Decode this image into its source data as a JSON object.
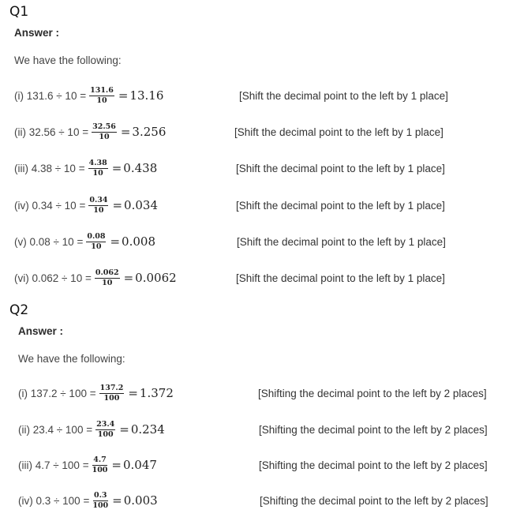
{
  "q1": {
    "title": "Q1",
    "answer_label": "Answer :",
    "intro": "We have the following:",
    "rows": [
      {
        "expr": "(i) 131.6 ÷ 10 =",
        "num": "131.6",
        "den": "10",
        "result": "13.16",
        "note": "[Shift the decimal point to the left by 1 place]"
      },
      {
        "expr": "(ii) 32.56 ÷ 10 =",
        "num": "32.56",
        "den": "10",
        "result": "3.256",
        "note": "[Shift the decimal point to the left by 1 place]"
      },
      {
        "expr": "(iii) 4.38 ÷ 10 =",
        "num": "4.38",
        "den": "10",
        "result": "0.438",
        "note": "[Shift the decimal point to the left by 1 place]"
      },
      {
        "expr": "(iv) 0.34 ÷ 10 =",
        "num": "0.34",
        "den": "10",
        "result": "0.034",
        "note": "[Shift the decimal point to the left by 1 place]"
      },
      {
        "expr": "(v) 0.08 ÷ 10 =",
        "num": "0.08",
        "den": "10",
        "result": "0.008",
        "note": "[Shift the decimal point to the left by 1 place]"
      },
      {
        "expr": "(vi) 0.062 ÷ 10 =",
        "num": "0.062",
        "den": "10",
        "result": "0.0062",
        "note": "[Shift the decimal point to the left by 1 place]"
      }
    ]
  },
  "q2": {
    "title": "Q2",
    "answer_label": "Answer :",
    "intro": "We have the following:",
    "rows": [
      {
        "expr": "(i) 137.2 ÷ 100 =",
        "num": "137.2",
        "den": "100",
        "result": "1.372",
        "note": "[Shifting the decimal point to the left by 2 places]"
      },
      {
        "expr": "(ii) 23.4 ÷ 100 =",
        "num": "23.4",
        "den": "100",
        "result": "0.234",
        "note": "[Shifting the decimal point to the left by 2 places]"
      },
      {
        "expr": "(iii) 4.7 ÷ 100 =",
        "num": "4.7",
        "den": "100",
        "result": "0.047",
        "note": "[Shifting the decimal point to the left by 2 places]"
      },
      {
        "expr": "(iv) 0.3 ÷ 100 =",
        "num": "0.3",
        "den": "100",
        "result": "0.003",
        "note": "[Shifting the decimal point to the left by 2 places]"
      }
    ]
  }
}
